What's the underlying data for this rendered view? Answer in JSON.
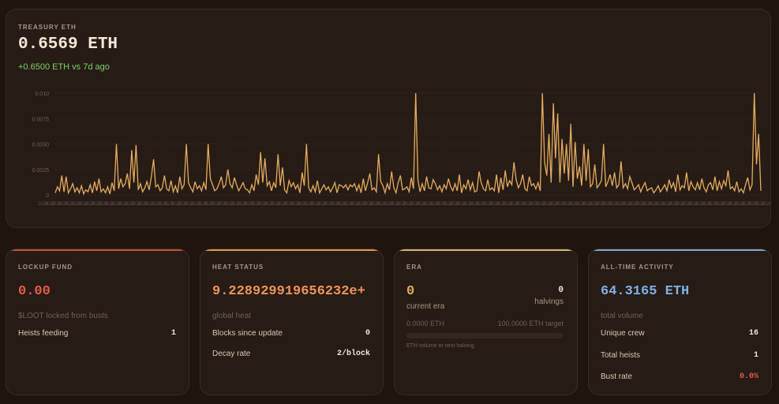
{
  "treasury": {
    "label": "TREASURY ETH",
    "value": "0.6569 ETH",
    "delta": "+0.6500 ETH vs 7d ago"
  },
  "chart_data": {
    "type": "line",
    "yticks": [
      "0.010",
      "0.0075",
      "0.0050",
      "0.0025",
      "0"
    ],
    "ylim": [
      0,
      0.01
    ],
    "x_tick_labels": "2026…",
    "grid": true,
    "series": [
      {
        "values": [
          0.0002,
          0.0008,
          0.0004,
          0.0019,
          0.0003,
          0.0018,
          0.0002,
          0.0006,
          0.0011,
          0.0003,
          0.0007,
          0.0002,
          0.0009,
          0.0001,
          0.0005,
          0.0003,
          0.001,
          0.0002,
          0.0013,
          0.0004,
          0.0016,
          0.0003,
          0.0006,
          0.0002,
          0.0008,
          0.0001,
          0.0012,
          0.0004,
          0.005,
          0.0006,
          0.0016,
          0.0008,
          0.0011,
          0.0021,
          0.0006,
          0.0044,
          0.0012,
          0.0049,
          0.0005,
          0.0011,
          0.0003,
          0.0007,
          0.0013,
          0.0005,
          0.0018,
          0.0035,
          0.0008,
          0.001,
          0.0004,
          0.0007,
          0.0019,
          0.0006,
          0.0004,
          0.0014,
          0.0003,
          0.0009,
          0.0002,
          0.0018,
          0.0006,
          0.001,
          0.005,
          0.0012,
          0.0007,
          0.0003,
          0.0013,
          0.0006,
          0.0009,
          0.0004,
          0.0012,
          0.0005,
          0.005,
          0.0016,
          0.001,
          0.0004,
          0.0006,
          0.0011,
          0.0018,
          0.0007,
          0.001,
          0.0025,
          0.0011,
          0.0007,
          0.0017,
          0.001,
          0.0004,
          0.0008,
          0.0012,
          0.0006,
          0.0005,
          0.0002,
          0.001,
          0.0004,
          0.002,
          0.001,
          0.0042,
          0.0012,
          0.0036,
          0.0009,
          0.0013,
          0.0004,
          0.0012,
          0.0007,
          0.004,
          0.0009,
          0.0027,
          0.0005,
          0.0002,
          0.0014,
          0.0008,
          0.0012,
          0.0006,
          0.001,
          0.0002,
          0.0022,
          0.0009,
          0.005,
          0.0007,
          0.0003,
          0.0009,
          0.0003,
          0.0014,
          0.0002,
          0.0006,
          0.001,
          0.0005,
          0.0008,
          0.0003,
          0.0007,
          0.0012,
          0.0002,
          0.001,
          0.0009,
          0.0007,
          0.001,
          0.0005,
          0.001,
          0.0008,
          0.0011,
          0.0004,
          0.001,
          0.0002,
          0.0016,
          0.0004,
          0.0012,
          0.0021,
          0.0005,
          0.0007,
          0.0003,
          0.004,
          0.0013,
          0.0009,
          0.0002,
          0.0011,
          0.0005,
          0.0023,
          0.0007,
          0.0002,
          0.0012,
          0.0019,
          0.0005,
          0.0006,
          0.0008,
          0.0003,
          0.0017,
          0.0006,
          0.01,
          0.0015,
          0.0003,
          0.0011,
          0.0004,
          0.0018,
          0.0007,
          0.0006,
          0.0015,
          0.0011,
          0.0005,
          0.0009,
          0.0003,
          0.001,
          0.0006,
          0.0016,
          0.0008,
          0.0004,
          0.0011,
          0.0004,
          0.002,
          0.0002,
          0.001,
          0.0006,
          0.0015,
          0.0005,
          0.0012,
          0.0003,
          0.0004,
          0.0023,
          0.0012,
          0.0006,
          0.0004,
          0.0015,
          0.0005,
          0.0007,
          0.0004,
          0.002,
          0.0002,
          0.0017,
          0.0005,
          0.0024,
          0.0008,
          0.0014,
          0.001,
          0.0032,
          0.0015,
          0.0007,
          0.0011,
          0.002,
          0.0006,
          0.0004,
          0.0018,
          0.0009,
          0.0011,
          0.0006,
          0.0012,
          0.0004,
          0.01,
          0.0032,
          0.0019,
          0.006,
          0.0012,
          0.009,
          0.0036,
          0.008,
          0.0012,
          0.0055,
          0.0021,
          0.005,
          0.0014,
          0.007,
          0.0008,
          0.0052,
          0.0016,
          0.0028,
          0.0009,
          0.005,
          0.0014,
          0.0045,
          0.0008,
          0.0011,
          0.003,
          0.0007,
          0.001,
          0.0014,
          0.005,
          0.0008,
          0.0013,
          0.002,
          0.0009,
          0.0022,
          0.0007,
          0.001,
          0.0033,
          0.0007,
          0.0011,
          0.0006,
          0.0018,
          0.0012,
          0.0005,
          0.0007,
          0.001,
          0.0003,
          0.0008,
          0.0012,
          0.0004,
          0.0006,
          0.0007,
          0.0002,
          0.0005,
          0.0009,
          0.0003,
          0.0006,
          0.001,
          0.0004,
          0.0015,
          0.0007,
          0.0012,
          0.0003,
          0.002,
          0.0005,
          0.0009,
          0.0007,
          0.0022,
          0.0004,
          0.0013,
          0.0008,
          0.0005,
          0.0012,
          0.0005,
          0.0016,
          0.0007,
          0.0003,
          0.001,
          0.0012,
          0.0005,
          0.0018,
          0.0004,
          0.0013,
          0.0006,
          0.0014,
          0.0009,
          0.0024,
          0.0006,
          0.0008,
          0.0004,
          0.0013,
          0.0003,
          0.0006,
          0.0002,
          0.001,
          0.0017,
          0.0005,
          0.001,
          0.01,
          0.003,
          0.006,
          0.0004
        ]
      }
    ]
  },
  "cards": {
    "lockup": {
      "label": "LOCKUP FUND",
      "value": "0.00",
      "sub": "$LOOT locked from busts",
      "row1_label": "Heists feeding",
      "row1_value": "1"
    },
    "heat": {
      "label": "HEAT STATUS",
      "value": "9.228929919656232e+",
      "sub": "global heat",
      "row1_label": "Blocks since update",
      "row1_value": "0",
      "row2_label": "Decay rate",
      "row2_value": "2/block"
    },
    "era": {
      "label": "ERA",
      "value": "0",
      "value_caption": "current era",
      "halvings_value": "0",
      "halvings_label": "halvings",
      "progress_left": "0.0000 ETH",
      "progress_right": "100.0000 ETH target",
      "progress_fraction": 0,
      "progress_caption": "ETH volume to next halving"
    },
    "activity": {
      "label": "ALL-TIME ACTIVITY",
      "value": "64.3165 ETH",
      "sub": "total volume",
      "row1_label": "Unique crew",
      "row1_value": "16",
      "row2_label": "Total heists",
      "row2_value": "1",
      "row3_label": "Bust rate",
      "row3_value": "0.0%"
    }
  },
  "colors": {
    "line": "#e6ab60",
    "lockup_accent": "#c9503a",
    "heat_accent": "#e8934d",
    "era_accent": "#d8b27a",
    "activity_accent": "#7fa6d6",
    "positive": "#7fcf6a",
    "bust": "#e65a4a"
  }
}
